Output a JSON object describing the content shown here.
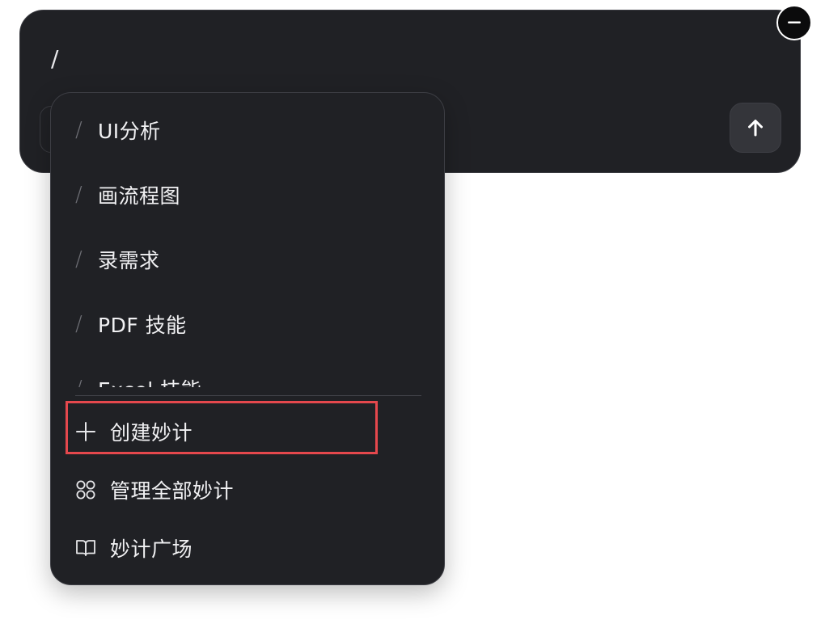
{
  "composer": {
    "input_value": "/"
  },
  "skills": {
    "items": [
      {
        "slash": "/",
        "label": "UI分析"
      },
      {
        "slash": "/",
        "label": "画流程图"
      },
      {
        "slash": "/",
        "label": "录需求"
      },
      {
        "slash": "/",
        "label": "PDF 技能"
      },
      {
        "slash": "/",
        "label": "Excel 技能"
      }
    ]
  },
  "actions": {
    "create": {
      "label": "创建妙计",
      "icon": "plus-icon"
    },
    "manage": {
      "label": "管理全部妙计",
      "icon": "grid-circles-icon"
    },
    "plaza": {
      "label": "妙计广场",
      "icon": "open-book-icon"
    }
  },
  "colors": {
    "panel_bg": "#202125",
    "highlight": "#e5484d",
    "text": "#f1f1f3"
  }
}
